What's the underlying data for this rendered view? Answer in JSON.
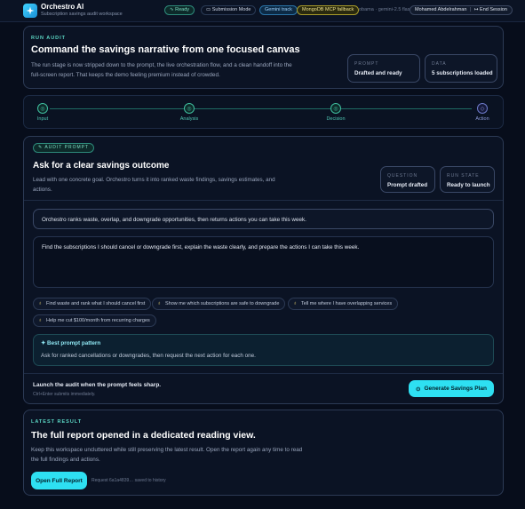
{
  "header": {
    "app_title": "Orchestro AI",
    "app_subtitle": "Subscription savings audit workspace",
    "ready_label": "Ready",
    "mode_label": "Submission Mode",
    "gemini_label": "Gemini track",
    "mongo_label": "MongoDB MCP fallback",
    "model_text": "obama · gemini-2.5 flash",
    "user_label": "Mohamed Abdelrahman",
    "end_session_label": "End Session"
  },
  "run_audit": {
    "eyebrow": "RUN AUDIT",
    "title": "Command the savings narrative from one focused canvas",
    "description": "The run stage is now stripped down to the prompt, the live orchestration flow, and a clean handoff into the full-screen report. That keeps the demo feeling premium instead of crowded.",
    "stats": [
      {
        "key": "PROMPT",
        "value": "Drafted and ready"
      },
      {
        "key": "DATA",
        "value": "5 subscriptions loaded"
      }
    ]
  },
  "stepper": {
    "steps": [
      "Input",
      "Analysis",
      "Decision",
      "Action"
    ]
  },
  "audit_prompt": {
    "badge": "AUDIT PROMPT",
    "title": "Ask for a clear savings outcome",
    "description": "Lead with one concrete goal. Orchestro turns it into ranked waste findings, savings estimates, and actions.",
    "stats": [
      {
        "key": "QUESTION",
        "value": "Prompt drafted"
      },
      {
        "key": "RUN STATE",
        "value": "Ready to launch"
      }
    ],
    "summary": "Orchestro ranks waste, overlap, and downgrade opportunities, then returns actions you can take this week.",
    "prompt_value": "Find the subscriptions I should cancel or downgrade first, explain the waste clearly, and prepare the actions I can take this week.",
    "chips": [
      "Find waste and rank what I should cancel first",
      "Show me which subscriptions are safe to downgrade",
      "Tell me where I have overlapping services",
      "Help me cut $100/month from recurring charges"
    ],
    "pattern_title": "Best prompt pattern",
    "pattern_text": "Ask for ranked cancellations or downgrades, then request the next action for each one.",
    "launch_title": "Launch the audit when the prompt feels sharp.",
    "launch_hint": "Ctrl+Enter submits immediately.",
    "generate_label": "Generate Savings Plan"
  },
  "latest_result": {
    "eyebrow": "LATEST RESULT",
    "title": "The full report opened in a dedicated reading view.",
    "description": "Keep this workspace uncluttered while still preserving the latest result. Open the report again any time to read the full findings and actions.",
    "open_label": "Open Full Report",
    "request_text": "Request 6a1a4839… saved to history"
  },
  "colors": {
    "accent": "#2ee0f2",
    "teal": "#5ad4c2",
    "background": "#070d1b",
    "card": "#0b1324"
  }
}
